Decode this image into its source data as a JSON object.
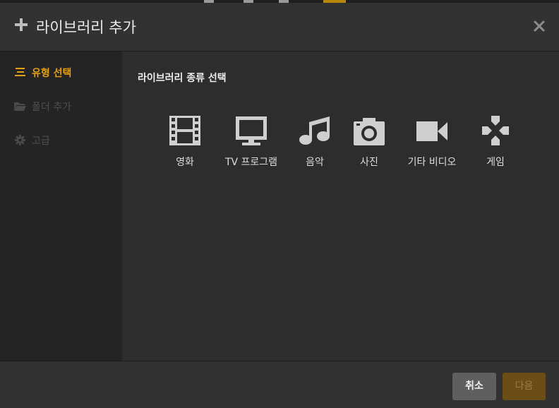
{
  "header": {
    "title": "라이브러리 추가",
    "plus_icon": "plus-icon",
    "close_icon": "close-icon"
  },
  "sidebar": {
    "items": [
      {
        "label": "유형 선택",
        "icon": "list-icon",
        "state": "active"
      },
      {
        "label": "폴더 추가",
        "icon": "folder-icon",
        "state": "disabled"
      },
      {
        "label": "고급",
        "icon": "gear-icon",
        "state": "disabled"
      }
    ]
  },
  "content": {
    "section_title": "라이브러리 종류 선택",
    "types": [
      {
        "label": "영화",
        "icon": "film-icon"
      },
      {
        "label": "TV 프로그램",
        "icon": "tv-icon"
      },
      {
        "label": "음악",
        "icon": "music-icon"
      },
      {
        "label": "사진",
        "icon": "camera-icon"
      },
      {
        "label": "기타 비디오",
        "icon": "video-camera-icon"
      },
      {
        "label": "게임",
        "icon": "gamepad-icon"
      }
    ]
  },
  "footer": {
    "cancel_label": "취소",
    "next_label": "다음"
  },
  "colors": {
    "accent": "#e5a00d",
    "icon": "#cfcfcf",
    "background": "#2d2d2d",
    "sidebar": "#242424"
  }
}
